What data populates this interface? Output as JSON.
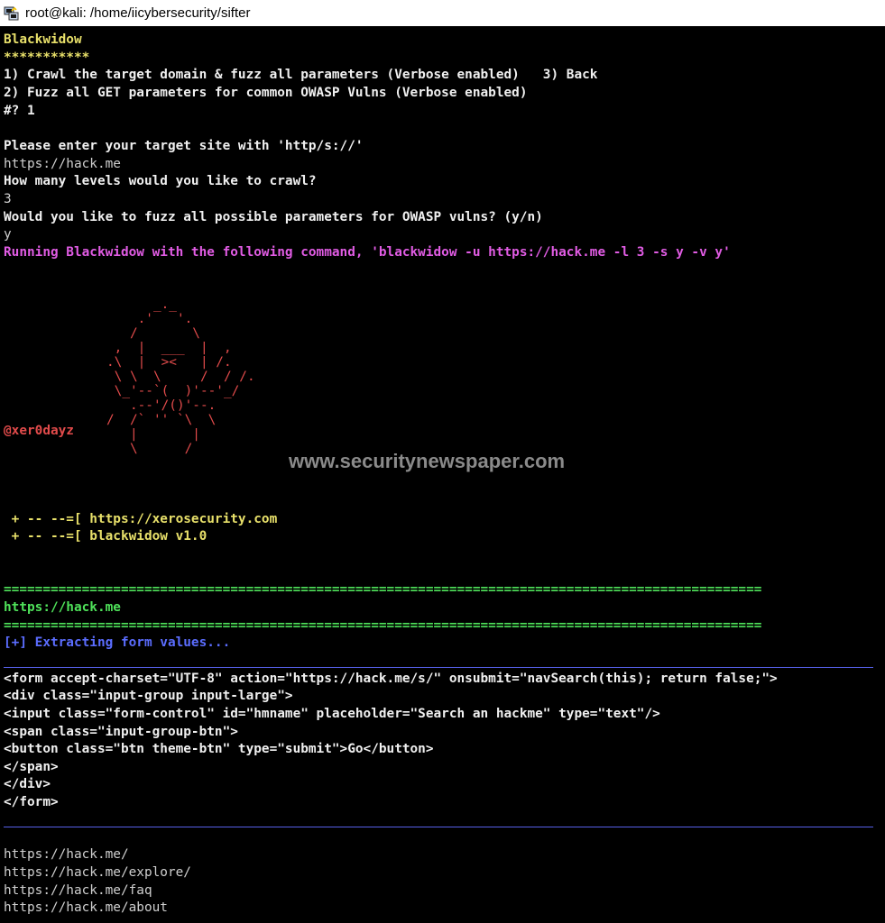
{
  "window": {
    "title": "root@kali: /home/iicybersecurity/sifter",
    "icon": "putty-icon"
  },
  "terminal": {
    "menu_title": "Blackwidow",
    "menu_stars": "***********",
    "menu_line1": "1) Crawl the target domain & fuzz all parameters (Verbose enabled)   3) Back",
    "menu_line2": "2) Fuzz all GET parameters for common OWASP Vulns (Verbose enabled)",
    "menu_prompt": "#? 1",
    "prompt_site": "Please enter your target site with 'http/s://'",
    "answer_site": "https://hack.me",
    "prompt_levels": "How many levels would you like to crawl?",
    "answer_levels": "3",
    "prompt_fuzz": "Would you like to fuzz all possible parameters for OWASP vulns? (y/n)",
    "answer_fuzz": "y",
    "running_line": "Running Blackwidow with the following command, 'blackwidow -u https://hack.me -l 3 -s y -v y'",
    "ascii_art": "         _._\n       .'   '.\n      /       \\\n    ,  |  ___  |  ,\n   .\\  |  ><   | /.\n    \\ \\  \\     /  / /.\n    \\_'--`(  )'--'_/\n      .--'/()'--.\n   /  /` '' `\\  \\\n      |       |\n      \\      /",
    "author_tag": "@xer0dayz",
    "banner_line1": " + -- --=[ https://xerosecurity.com",
    "banner_line2": " + -- --=[ blackwidow v1.0",
    "separator_line": "=================================================================================================",
    "target_url": "https://hack.me",
    "extracting_line": "[+] Extracting form values...",
    "form_lines": [
      "<form accept-charset=\"UTF-8\" action=\"https://hack.me/s/\" onsubmit=\"navSearch(this); return false;\">",
      "<div class=\"input-group input-large\">",
      "<input class=\"form-control\" id=\"hmname\" placeholder=\"Search an hackme\" type=\"text\"/>",
      "<span class=\"input-group-btn\">",
      "<button class=\"btn theme-btn\" type=\"submit\">Go</button>",
      "</span>",
      "</div>",
      "</form>"
    ],
    "crawled_urls": [
      "https://hack.me/",
      "https://hack.me/explore/",
      "https://hack.me/faq",
      "https://hack.me/about"
    ]
  },
  "watermark": "www.securitynewspaper.com",
  "colors": {
    "background": "#000000",
    "yellow": "#e8e06a",
    "magenta": "#e15ce4",
    "red": "#e24b4b",
    "green": "#4fe25a",
    "blue": "#5b6dff"
  }
}
